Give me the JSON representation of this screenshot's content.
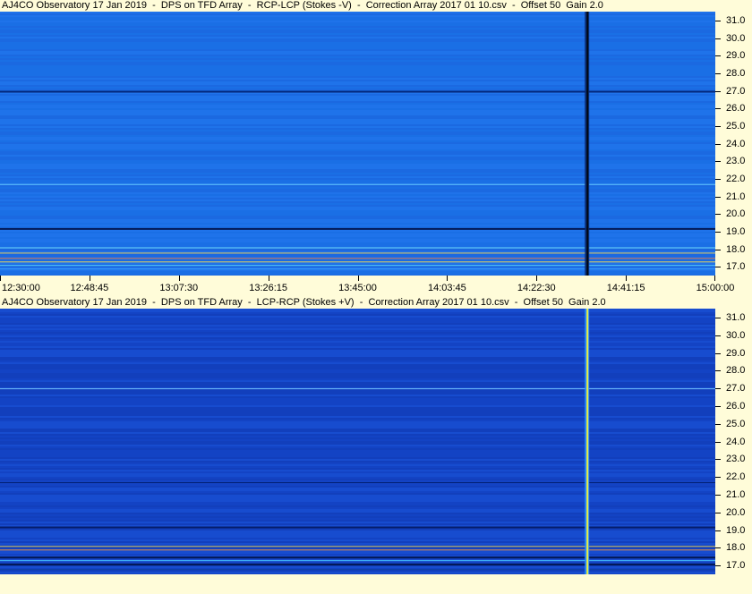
{
  "colors": {
    "background": "#fffcd9",
    "panel1_base": "#1a6ee6",
    "panel2_base": "#1446c8"
  },
  "chart_data": [
    {
      "type": "heatmap",
      "title": "AJ4CO Observatory 17 Jan 2019  -  DPS on TFD Array  -  RCP-LCP (Stokes -V)  -  Correction Array 2017 01 10.csv  -  Offset 50  Gain 2.0",
      "y_tick_labels": [
        "31.0",
        "30.0",
        "29.0",
        "28.0",
        "27.0",
        "26.0",
        "25.0",
        "24.0",
        "23.0",
        "22.0",
        "21.0",
        "20.0",
        "19.0",
        "18.0",
        "17.0"
      ],
      "ylim": [
        16.5,
        31.5
      ],
      "burst_time": "14:33"
    },
    {
      "type": "heatmap",
      "title": "AJ4CO Observatory 17 Jan 2019  -  DPS on TFD Array  -  LCP-RCP (Stokes +V)  -  Correction Array 2017 01 10.csv  -  Offset 50  Gain 2.0",
      "y_tick_labels": [
        "31.0",
        "30.0",
        "29.0",
        "28.0",
        "27.0",
        "26.0",
        "25.0",
        "24.0",
        "23.0",
        "22.0",
        "21.0",
        "20.0",
        "19.0",
        "18.0",
        "17.0"
      ],
      "ylim": [
        16.5,
        31.5
      ],
      "burst_time": "14:33"
    }
  ],
  "x_axis": {
    "tick_labels": [
      "12:30:00",
      "12:48:45",
      "13:07:30",
      "13:26:15",
      "13:45:00",
      "14:03:45",
      "14:22:30",
      "14:41:15",
      "15:00:00"
    ]
  }
}
